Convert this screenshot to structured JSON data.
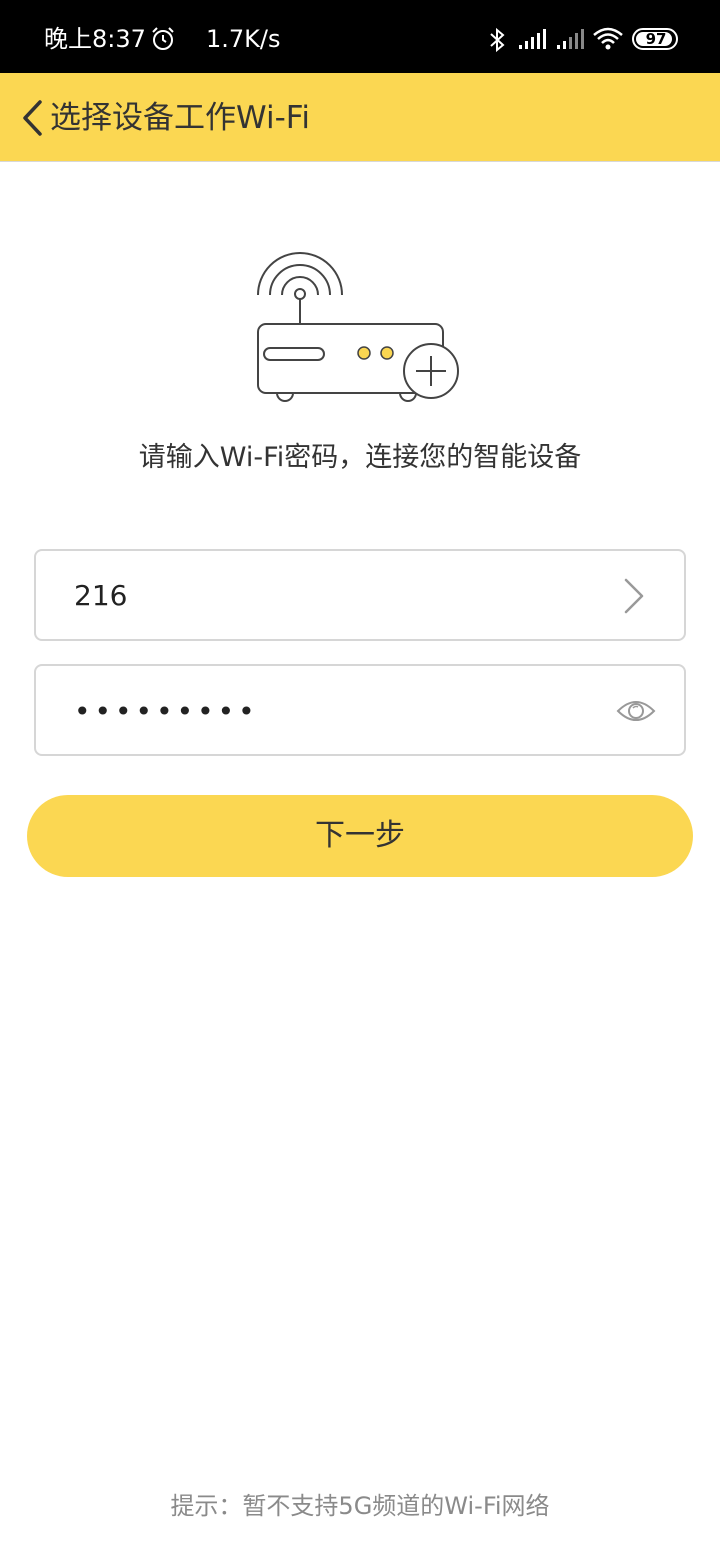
{
  "status_bar": {
    "time": "晚上8:37",
    "net_speed": "1.7K/s",
    "battery": "97"
  },
  "app_bar": {
    "title": "选择设备工作Wi-Fi"
  },
  "main": {
    "hint": "请输入Wi-Fi密码，连接您的智能设备",
    "ssid_value": "216",
    "password_value": "123456789",
    "next_label": "下一步"
  },
  "footer": {
    "hint": "提示：暂不支持5G频道的Wi-Fi网络"
  },
  "colors": {
    "accent": "#fbd752",
    "status_bar_bg": "#000000",
    "field_border": "#d6d6d6"
  },
  "icons": {
    "back": "chevron-left-icon",
    "alarm": "alarm-icon",
    "bluetooth": "bluetooth-icon",
    "signal": "signal-icon",
    "wifi": "wifi-icon",
    "battery": "battery-icon",
    "chevron": "chevron-right-icon",
    "eye": "eye-icon",
    "router": "router-icon"
  }
}
